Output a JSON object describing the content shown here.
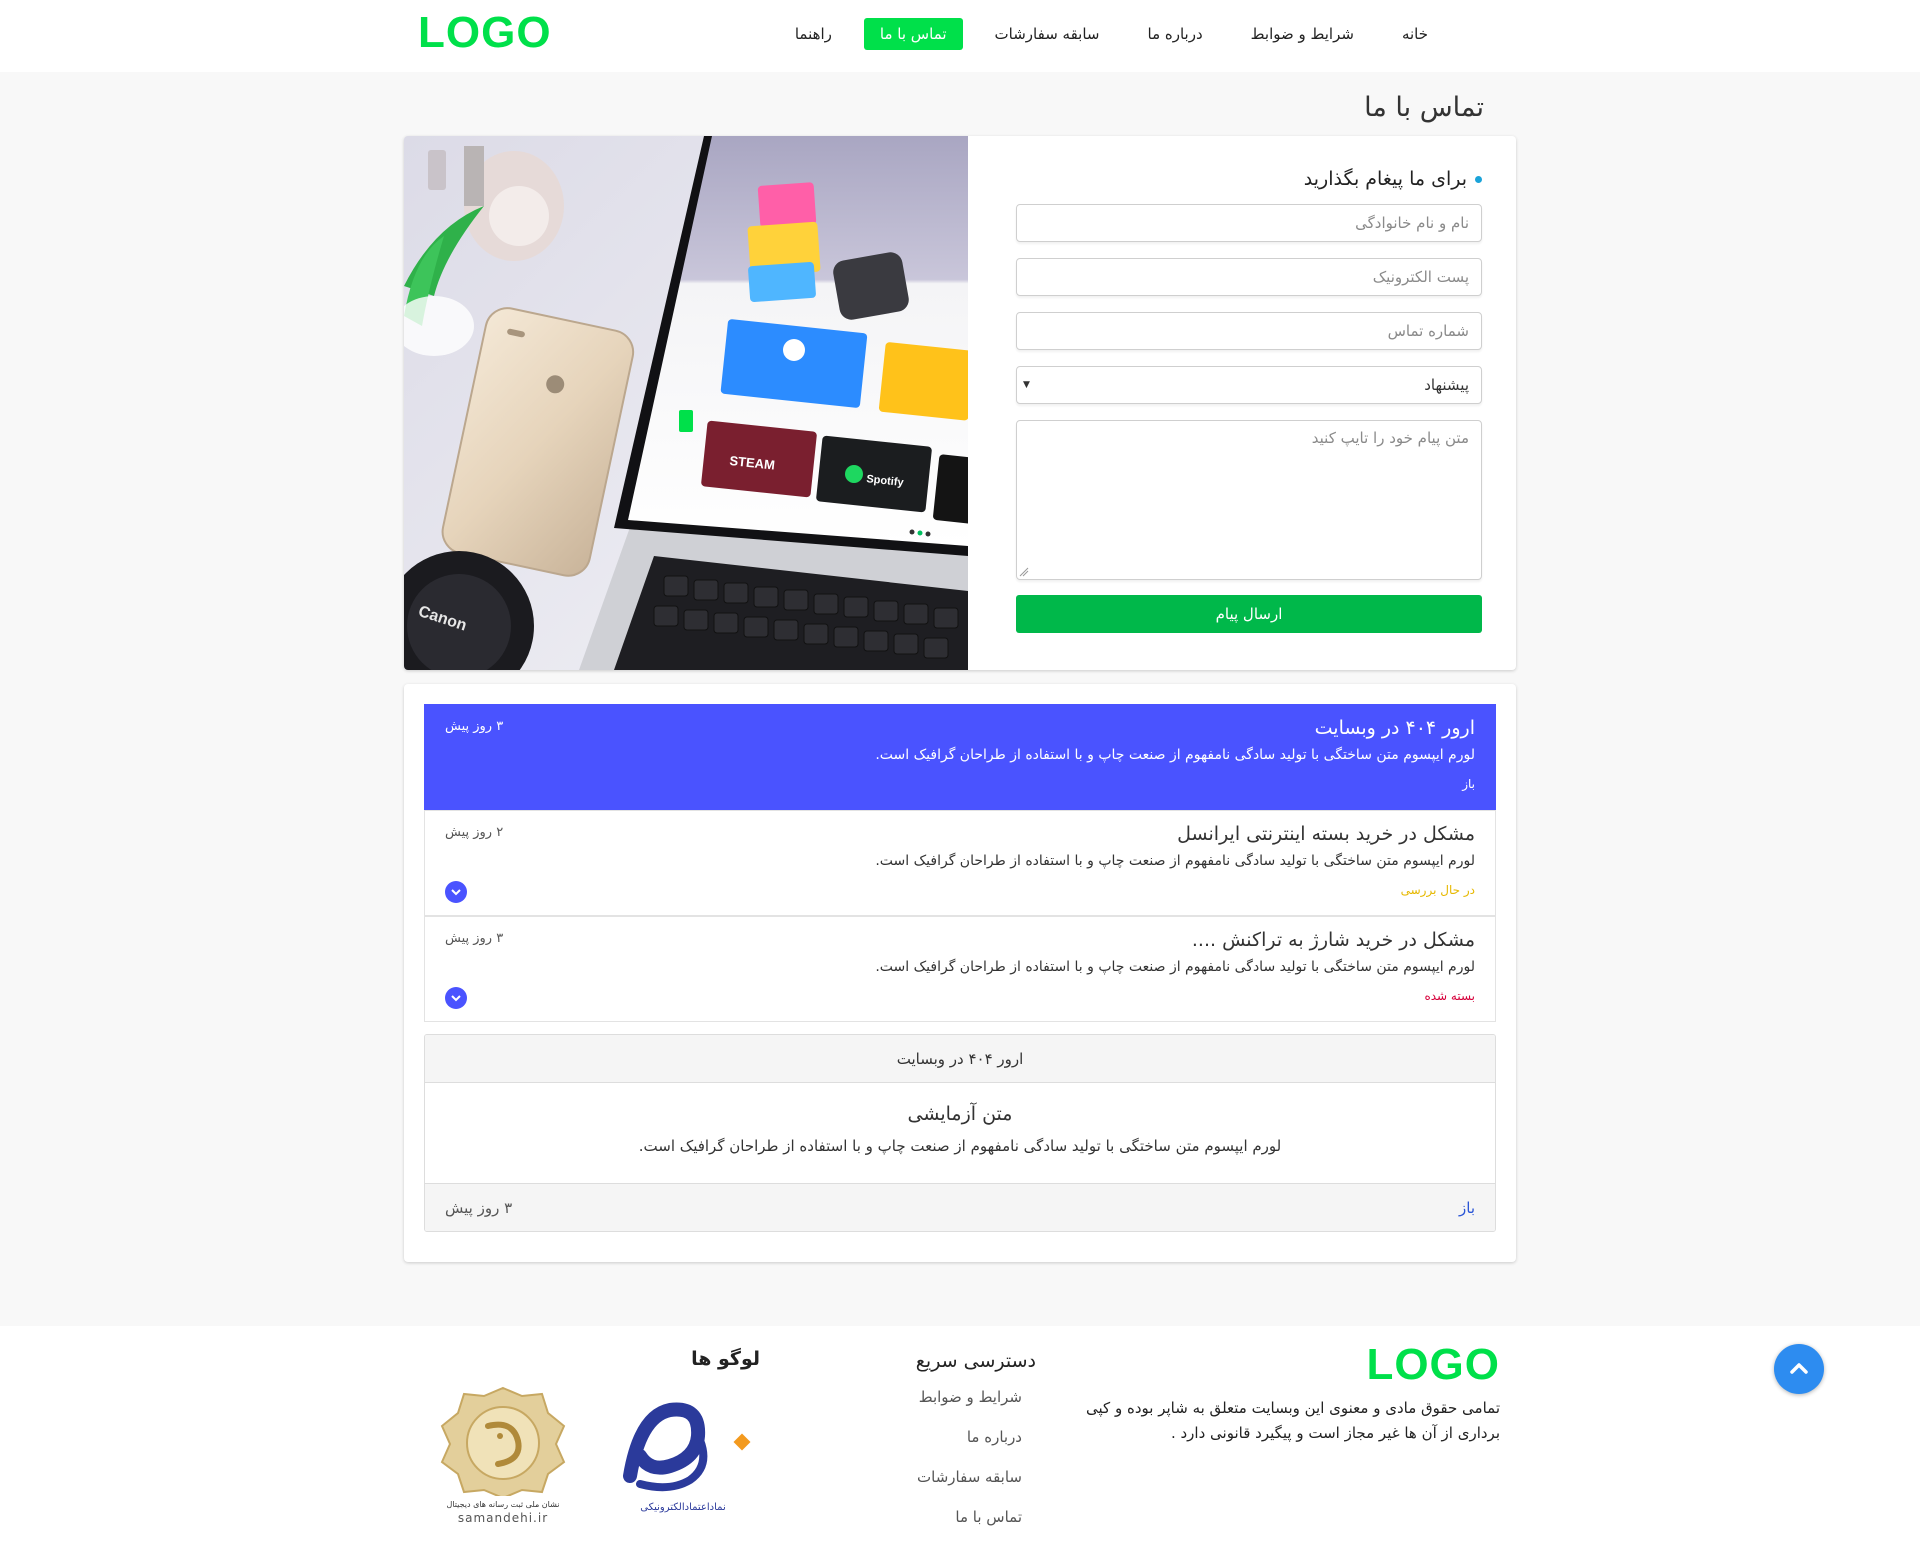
{
  "header": {
    "logo": "LOGO",
    "nav": [
      {
        "label": "خانه",
        "active": false
      },
      {
        "label": "شرایط و ضوابط",
        "active": false
      },
      {
        "label": "درباره ما",
        "active": false
      },
      {
        "label": "سابقه سفارشات",
        "active": false
      },
      {
        "label": "تماس با ما",
        "active": true
      },
      {
        "label": "راهنما",
        "active": false
      }
    ]
  },
  "page": {
    "title": "تماس با ما"
  },
  "contact_form": {
    "heading": "برای ما پیغام بگذارید",
    "name_placeholder": "نام و نام خانوادگی",
    "email_placeholder": "پست الکترونیک",
    "phone_placeholder": "شماره تماس",
    "subject_selected": "پیشنهاد",
    "message_placeholder": "متن پیام خود را تایپ کنید",
    "submit_label": "ارسال پیام"
  },
  "photo": {
    "screen_text": [
      "STEAM",
      "Spotify",
      "Canon"
    ]
  },
  "tickets": [
    {
      "title": "ارور ۴۰۴ در وبسایت",
      "desc": "لورم ایپسوم متن ساختگی با تولید سادگی نامفهوم از صنعت چاپ و با استفاده از طراحان گرافیک است.",
      "status": "باز",
      "status_color": "#ffffff",
      "time": "۳ روز پیش",
      "active": true
    },
    {
      "title": "مشکل در خرید بسته اینترنتی ایرانسل",
      "desc": "لورم ایپسوم متن ساختگی با تولید سادگی نامفهوم از صنعت چاپ و با استفاده از طراحان گرافیک است.",
      "status": "در حال بررسی",
      "status_color": "#e6b800",
      "time": "۲ روز پیش",
      "active": false
    },
    {
      "title": "مشکل در خرید شارژ به تراکنش ....",
      "desc": "لورم ایپسوم متن ساختگی با تولید سادگی نامفهوم از صنعت چاپ و با استفاده از طراحان گرافیک است.",
      "status": "بسته شده",
      "status_color": "#d6003a",
      "time": "۳ روز پیش",
      "active": false
    }
  ],
  "ticket_detail": {
    "header": "ارور ۴۰۴ در وبسایت",
    "title": "متن آزمایشی",
    "text": "لورم ایپسوم متن ساختگی با تولید سادگی نامفهوم از صنعت چاپ و با استفاده از طراحان گرافیک است.",
    "status": "باز",
    "time": "۳ روز پیش"
  },
  "footer": {
    "logo": "LOGO",
    "about": "تمامی حقوق مادی و معنوی این وبسایت متعلق به شاپر بوده و کپی برداری از آن ها غیر مجاز است و پیگیرد قانونی دارد .",
    "quick_links_title": "دسترسی سریع",
    "quick_links": [
      "شرایط و ضوابط",
      "درباره ما",
      "سابقه سفارشات",
      "تماس با ما"
    ],
    "logos_title": "لوگو ها",
    "enamad_caption": "نمادا‌عتمادالکترونیکی",
    "samandehi_caption": "نشان ملی ثبت رسانه های دیجیتال",
    "samandehi_url": "samandehi.ir"
  },
  "colors": {
    "brand_green": "#00e04a",
    "submit_green": "#00b84a",
    "ticket_active": "#4a53ff",
    "scroll_top": "#2d8cf0"
  }
}
